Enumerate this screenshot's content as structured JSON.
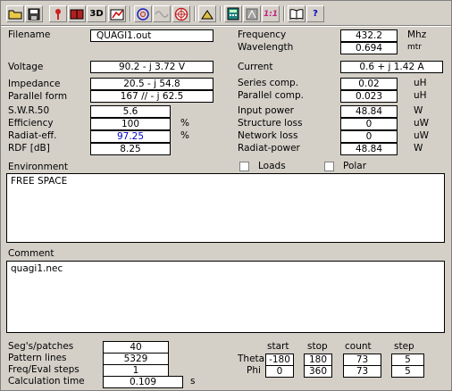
{
  "toolbar": {
    "icons": [
      "folder-icon",
      "disk-icon",
      "antenna-icon",
      "book-icon",
      "3d-view-icon",
      "chart-icon",
      "pattern-icon",
      "swr-icon",
      "target-icon",
      "settings-icon",
      "calculator-icon",
      "currents-icon",
      "ratio-icon",
      "manual-icon",
      "help-icon"
    ],
    "label_3d": "3D",
    "label_ratio": "1:1",
    "label_help": "?"
  },
  "fields": {
    "filename_label": "Filename",
    "filename_value": "QUAGI1.out",
    "frequency_label": "Frequency",
    "frequency_value": "432.2",
    "frequency_unit": "Mhz",
    "wavelength_label": "Wavelength",
    "wavelength_value": "0.694",
    "wavelength_unit": "mtr",
    "voltage_label": "Voltage",
    "voltage_value": "90.2 - j 3.72 V",
    "current_label": "Current",
    "current_value": "0.6 + j 1.42 A",
    "impedance_label": "Impedance",
    "impedance_value": "20.5 - j 54.8",
    "parallel_form_label": "Parallel form",
    "parallel_form_value": "167 // - j 62.5",
    "series_comp_label": "Series comp.",
    "series_comp_value": "0.02",
    "series_comp_unit": "uH",
    "parallel_comp_label": "Parallel comp.",
    "parallel_comp_value": "0.023",
    "parallel_comp_unit": "uH",
    "swr_label": "S.W.R.50",
    "swr_value": "5.6",
    "input_power_label": "Input power",
    "input_power_value": "48.84",
    "input_power_unit": "W",
    "efficiency_label": "Efficiency",
    "efficiency_value": "100",
    "efficiency_unit": "%",
    "structure_loss_label": "Structure loss",
    "structure_loss_value": "0",
    "structure_loss_unit": "uW",
    "radiat_eff_label": "Radiat-eff.",
    "radiat_eff_value": "97.25",
    "radiat_eff_unit": "%",
    "network_loss_label": "Network loss",
    "network_loss_value": "0",
    "network_loss_unit": "uW",
    "rdf_label": "RDF [dB]",
    "rdf_value": "8.25",
    "radiat_power_label": "Radiat-power",
    "radiat_power_value": "48.84",
    "radiat_power_unit": "W"
  },
  "environment": {
    "label": "Environment",
    "loads_label": "Loads",
    "polar_label": "Polar",
    "text": "FREE SPACE"
  },
  "comment": {
    "label": "Comment",
    "text": "quagi1.nec"
  },
  "bottom": {
    "segs_label": "Seg's/patches",
    "segs_value": "40",
    "pattern_lines_label": "Pattern lines",
    "pattern_lines_value": "5329",
    "freq_steps_label": "Freq/Eval steps",
    "freq_steps_value": "1",
    "calc_time_label": "Calculation time",
    "calc_time_value": "0.109",
    "calc_time_unit": "s",
    "col_start": "start",
    "col_stop": "stop",
    "col_count": "count",
    "col_step": "step",
    "theta_label": "Theta",
    "theta_start": "-180",
    "theta_stop": "180",
    "theta_count": "73",
    "theta_step": "5",
    "phi_label": "Phi",
    "phi_start": "0",
    "phi_stop": "360",
    "phi_count": "73",
    "phi_step": "5"
  }
}
